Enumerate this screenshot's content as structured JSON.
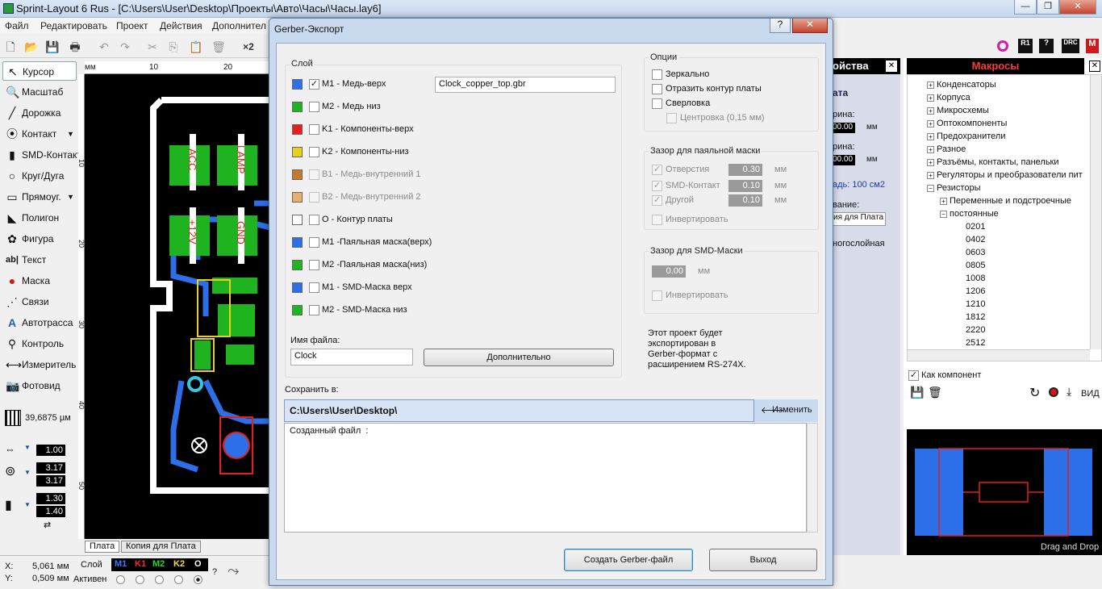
{
  "app": {
    "title": "Sprint-Layout 6 Rus - [C:\\Users\\User\\Desktop\\Проекты\\Авто\\Часы\\Часы.lay6]"
  },
  "menu": [
    "Файл",
    "Редактировать",
    "Проект",
    "Действия",
    "Дополнител"
  ],
  "toolbar": {
    "x2": "×2"
  },
  "tools": [
    "Курсор",
    "Масштаб",
    "Дорожка",
    "Контакт",
    "SMD-Контакт",
    "Круг/Дуга",
    "Прямоуг.",
    "Полигон",
    "Фигура",
    "Текст",
    "Маска",
    "Связи",
    "Автотрасса",
    "Контроль",
    "Измеритель",
    "Фотовид"
  ],
  "grid": {
    "value": "39,6875 µм"
  },
  "params": {
    "track": "1.00",
    "pad1": "3.17",
    "pad2": "3.17",
    "smd1": "1.30",
    "smd2": "1.40"
  },
  "ruler": {
    "unit": "мм",
    "t0": "10",
    "t20": "20",
    "l10": "10",
    "l20": "20",
    "l30": "30",
    "l40": "40",
    "l50": "50"
  },
  "board_labels": {
    "acc": "ACC",
    "lamp": "LAMP",
    "p12": "+12V",
    "gnd": "GND"
  },
  "tabs": {
    "board": "Плата",
    "copy": "Копия для Плата"
  },
  "status": {
    "x_label": "X:",
    "x": "5,061 мм",
    "y_label": "Y:",
    "y": "0,509 мм",
    "layer": "Слой",
    "active": "Активен",
    "m1": "M1",
    "k1": "K1",
    "m2": "M2",
    "k2": "K2",
    "o": "O",
    "q": "?"
  },
  "props_panel": {
    "header": "ойства",
    "r1": "ата",
    "r2": "рина:",
    "w_val": "00.00",
    "w_unit": "мм",
    "r3": "рина:",
    "h_val": "00.00",
    "h_unit": "мм",
    "area": "адь: 100 см2",
    "r4": "вание:",
    "name": "ия для Плата",
    "multi": "ногослойная"
  },
  "macros": {
    "header": "Макросы",
    "tree": [
      "Конденсаторы",
      "Корпуса",
      "Микросхемы",
      "Оптокомпоненты",
      "Предохранители",
      "Разное",
      "Разъёмы, контакты, панельки",
      "Регуляторы и преобразователи пит",
      "Резисторы"
    ],
    "sub1": "Переменные и подстроечные",
    "sub2": "постоянные",
    "items": [
      "0201",
      "0402",
      "0603",
      "0805",
      "1008",
      "1206",
      "1210",
      "1812",
      "2220",
      "2512"
    ],
    "as_component": "Как компонент",
    "view": "ВИД",
    "drag": "Drag and Drop"
  },
  "dialog": {
    "title": "Gerber-Экспорт",
    "help": "?",
    "close": "✕",
    "layer_group": "Слой",
    "layers": [
      {
        "label": "M1 - Медь-верх",
        "checked": true,
        "enabled": true,
        "color": "#2d6fe8"
      },
      {
        "label": "M2 - Медь низ",
        "checked": false,
        "enabled": true,
        "color": "#1fb31f"
      },
      {
        "label": "K1 - Компоненты-верх",
        "checked": false,
        "enabled": true,
        "color": "#e81e1e"
      },
      {
        "label": "K2 - Компоненты-низ",
        "checked": false,
        "enabled": true,
        "color": "#e6d21e"
      },
      {
        "label": "B1 - Медь-внутренний 1",
        "checked": false,
        "enabled": false,
        "color": "#c47a2a"
      },
      {
        "label": "B2 - Медь-внутренний 2",
        "checked": false,
        "enabled": false,
        "color": "#e8b070"
      },
      {
        "label": "O - Контур платы",
        "checked": false,
        "enabled": true,
        "color": "#ffffff"
      },
      {
        "label": "M1 -Паяльная маска(верх)",
        "checked": false,
        "enabled": true,
        "color": "#2d6fe8"
      },
      {
        "label": "M2 -Паяльная маска(низ)",
        "checked": false,
        "enabled": true,
        "color": "#1fb31f"
      },
      {
        "label": "M1 - SMD-Маска верх",
        "checked": false,
        "enabled": true,
        "color": "#2d6fe8"
      },
      {
        "label": "M2 - SMD-Маска низ",
        "checked": false,
        "enabled": true,
        "color": "#1fb31f"
      }
    ],
    "layer_file": "Clock_copper_top.gbr",
    "filename_label": "Имя файла:",
    "filename": "Clock",
    "more_button": "Дополнительно",
    "options": {
      "title": "Опции",
      "mirror": "Зеркально",
      "outline": "Отразить контур платы",
      "drill": "Сверловка",
      "center": "Центровка (0,15 мм)"
    },
    "mask_gap": {
      "title": "Зазор для паяльной маски",
      "holes": "Отверстия",
      "holes_val": "0.30",
      "smd": "SMD-Контакт",
      "smd_val": "0.10",
      "other": "Другой",
      "other_val": "0.10",
      "unit": "мм",
      "invert": "Инвертировать"
    },
    "smd_gap": {
      "title": "Зазор для SMD-Маски",
      "val": "0.00",
      "unit": "мм",
      "invert": "Инвертировать"
    },
    "info": [
      "Этот проект будет",
      "экспортирован в",
      "Gerber-формат с",
      "расширением RS-274X."
    ],
    "save_label": "Сохранить в:",
    "save_path": "C:\\Users\\User\\Desktop\\",
    "change_button": "Изменить",
    "log_text": "Созданный файл  :",
    "create_button": "Создать Gerber-файл",
    "exit_button": "Выход"
  }
}
